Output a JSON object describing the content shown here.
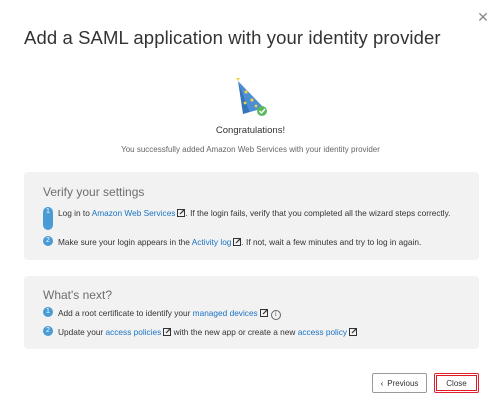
{
  "dialog": {
    "title": "Add a SAML application with your identity provider",
    "close_icon": "close-icon"
  },
  "success": {
    "icon": "party-hat-icon",
    "heading": "Congratulations!",
    "message": "You successfully added Amazon Web Services with your identity provider"
  },
  "verify": {
    "title": "Verify your settings",
    "steps": [
      {
        "num": "1",
        "pre": "Log in to ",
        "link": "Amazon Web Services",
        "post": ". If the login fails, verify that you completed all the wizard steps correctly."
      },
      {
        "num": "2",
        "pre": "Make sure your login appears in the ",
        "link": "Activity log",
        "post": ". If not, wait a few minutes and try to log in again."
      }
    ]
  },
  "next": {
    "title": "What's next?",
    "steps": [
      {
        "num": "1",
        "pre": "Add a root certificate to identify your ",
        "link": "managed devices",
        "info_icon": "i"
      },
      {
        "num": "2",
        "pre": "Update your ",
        "link": "access policies",
        "mid": " with the new app or create a new ",
        "link2": "access policy"
      }
    ]
  },
  "footer": {
    "previous_label": "Previous",
    "previous_icon": "‹",
    "close_label": "Close"
  },
  "colors": {
    "link": "#1a73c4",
    "step_badge": "#4a9ad6",
    "panel_bg": "#f2f2f2",
    "close_highlight": "#e21b23"
  }
}
